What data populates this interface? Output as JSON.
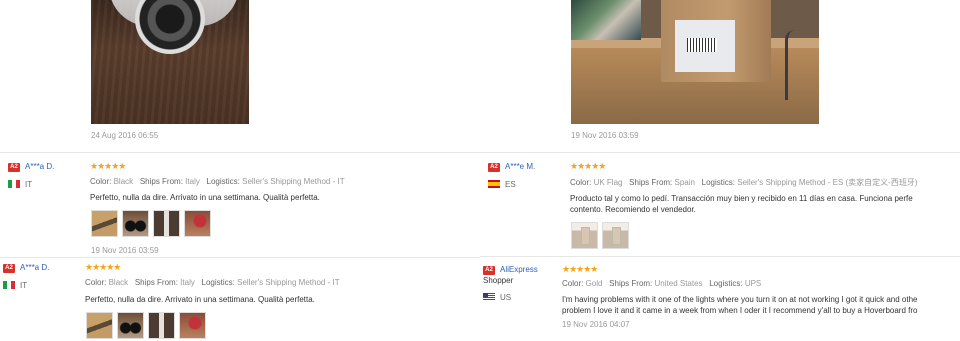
{
  "left": {
    "top_date": "24 Aug 2016 06:55",
    "reviews": [
      {
        "badge": "A2",
        "name": "A***a D.",
        "country": "IT",
        "stars": "★★★★★",
        "color_label": "Color:",
        "color": "Black",
        "ships_label": "Ships From:",
        "ships": "Italy",
        "logistics_label": "Logistics:",
        "logistics": "Seller's Shipping Method - IT",
        "text": "Perfetto, nulla da dire. Arrivato in una settimana. Qualità perfetta.",
        "date": "19 Nov 2016 03:59"
      },
      {
        "badge": "A2",
        "name": "A***a D.",
        "country": "IT",
        "stars": "★★★★★",
        "color_label": "Color:",
        "color": "Black",
        "ships_label": "Ships From:",
        "ships": "Italy",
        "logistics_label": "Logistics:",
        "logistics": "Seller's Shipping Method - IT",
        "text": "Perfetto, nulla da dire. Arrivato in una settimana. Qualità perfetta."
      }
    ]
  },
  "right": {
    "top_date": "19 Nov 2016 03:59",
    "reviews": [
      {
        "badge": "A2",
        "name": "A***e M.",
        "country": "ES",
        "stars": "★★★★★",
        "color_label": "Color:",
        "color": "UK Flag",
        "ships_label": "Ships From:",
        "ships": "Spain",
        "logistics_label": "Logistics:",
        "logistics": "Seller's Shipping Method - ES (卖家自定义-西班牙)",
        "text_line1": "Producto tal y como lo pedí. Transacción muy bien y recibido en 11 días en casa. Funciona perfe",
        "text_line2": "contento. Recomiendo el vendedor."
      },
      {
        "badge": "A2",
        "name_line1": "AliExpress",
        "name_line2": "Shopper",
        "country": "US",
        "stars": "★★★★★",
        "color_label": "Color:",
        "color": "Gold",
        "ships_label": "Ships From:",
        "ships": "United States",
        "logistics_label": "Logistics:",
        "logistics": "UPS",
        "text_line1": "I'm having problems with it one of the lights where you turn it on at not working I got it quick and othe",
        "text_line2": "problem I love it and it came in a week from when I oder it I recommend y'all to buy a Hoverboard fro",
        "date": "19 Nov 2016 04:07"
      }
    ]
  }
}
